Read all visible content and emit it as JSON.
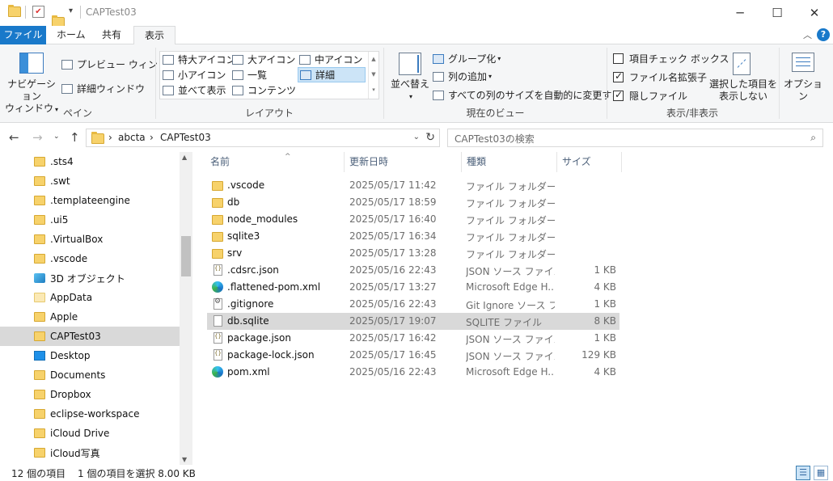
{
  "window": {
    "title": "CAPTest03",
    "minimize": "─",
    "maximize": "☐",
    "close": "✕",
    "qa_dropdown": "▾"
  },
  "ribbon_tabs": [
    {
      "label": "ファイル"
    },
    {
      "label": "ホーム"
    },
    {
      "label": "共有"
    },
    {
      "label": "表示"
    }
  ],
  "ribbon": {
    "pane": {
      "nav_pane_line1": "ナビゲーション",
      "nav_pane_line2": "ウィンドウ",
      "preview_pane": "プレビュー ウィンドウ",
      "details_pane": "詳細ウィンドウ",
      "label": "ペイン"
    },
    "layout": {
      "items": [
        "特大アイコン",
        "大アイコン",
        "中アイコン",
        "小アイコン",
        "一覧",
        "詳細",
        "並べて表示",
        "コンテンツ"
      ],
      "selected": "詳細",
      "label": "レイアウト"
    },
    "current_view": {
      "sort_by": "並べ替え",
      "group_by": "グループ化",
      "add_columns": "列の追加",
      "size_all_columns": "すべての列のサイズを自動的に変更する",
      "label": "現在のビュー"
    },
    "show_hide": {
      "item_checkboxes": {
        "label": "項目チェック ボックス",
        "checked": false
      },
      "file_extensions": {
        "label": "ファイル名拡張子",
        "checked": true
      },
      "hidden_items": {
        "label": "隠しファイル",
        "checked": true
      },
      "hide_selected_line1": "選択した項目を",
      "hide_selected_line2": "表示しない",
      "label": "表示/非表示"
    },
    "options": "オプション"
  },
  "address": {
    "segments": [
      "abcta",
      "CAPTest03"
    ],
    "separator": "›",
    "search_placeholder": "CAPTest03の検索"
  },
  "nav_pane": {
    "items": [
      {
        "label": ".sts4",
        "icon": "folder"
      },
      {
        "label": ".swt",
        "icon": "folder"
      },
      {
        "label": ".templateengine",
        "icon": "folder"
      },
      {
        "label": ".ui5",
        "icon": "folder"
      },
      {
        "label": ".VirtualBox",
        "icon": "folder"
      },
      {
        "label": ".vscode",
        "icon": "folder"
      },
      {
        "label": "3D オブジェクト",
        "icon": "cube"
      },
      {
        "label": "AppData",
        "icon": "folder-light"
      },
      {
        "label": "Apple",
        "icon": "folder"
      },
      {
        "label": "CAPTest03",
        "icon": "folder",
        "selected": true
      },
      {
        "label": "Desktop",
        "icon": "desk"
      },
      {
        "label": "Documents",
        "icon": "folder"
      },
      {
        "label": "Dropbox",
        "icon": "folder"
      },
      {
        "label": "eclipse-workspace",
        "icon": "folder"
      },
      {
        "label": "iCloud Drive",
        "icon": "folder"
      },
      {
        "label": "iCloud写真",
        "icon": "folder"
      }
    ]
  },
  "file_list": {
    "columns": [
      "名前",
      "更新日時",
      "種類",
      "サイズ"
    ],
    "rows": [
      {
        "name": ".vscode",
        "date": "2025/05/17 11:42",
        "type": "ファイル フォルダー",
        "size": "",
        "icon": "folder"
      },
      {
        "name": "db",
        "date": "2025/05/17 18:59",
        "type": "ファイル フォルダー",
        "size": "",
        "icon": "folder"
      },
      {
        "name": "node_modules",
        "date": "2025/05/17 16:40",
        "type": "ファイル フォルダー",
        "size": "",
        "icon": "folder"
      },
      {
        "name": "sqlite3",
        "date": "2025/05/17 16:34",
        "type": "ファイル フォルダー",
        "size": "",
        "icon": "folder"
      },
      {
        "name": "srv",
        "date": "2025/05/17 13:28",
        "type": "ファイル フォルダー",
        "size": "",
        "icon": "folder"
      },
      {
        "name": ".cdsrc.json",
        "date": "2025/05/16 22:43",
        "type": "JSON ソース ファイル",
        "size": "1 KB",
        "icon": "json"
      },
      {
        "name": ".flattened-pom.xml",
        "date": "2025/05/17 13:27",
        "type": "Microsoft Edge H...",
        "size": "4 KB",
        "icon": "edge"
      },
      {
        "name": ".gitignore",
        "date": "2025/05/16 22:43",
        "type": "Git Ignore ソース フ...",
        "size": "1 KB",
        "icon": "gear"
      },
      {
        "name": "db.sqlite",
        "date": "2025/05/17 19:07",
        "type": "SQLITE ファイル",
        "size": "8 KB",
        "icon": "doc",
        "selected": true
      },
      {
        "name": "package.json",
        "date": "2025/05/17 16:42",
        "type": "JSON ソース ファイル",
        "size": "1 KB",
        "icon": "json"
      },
      {
        "name": "package-lock.json",
        "date": "2025/05/17 16:45",
        "type": "JSON ソース ファイル",
        "size": "129 KB",
        "icon": "json"
      },
      {
        "name": "pom.xml",
        "date": "2025/05/16 22:43",
        "type": "Microsoft Edge H...",
        "size": "4 KB",
        "icon": "edge"
      }
    ]
  },
  "status": {
    "item_count": "12 個の項目",
    "selection": "1 個の項目を選択 8.00 KB"
  }
}
